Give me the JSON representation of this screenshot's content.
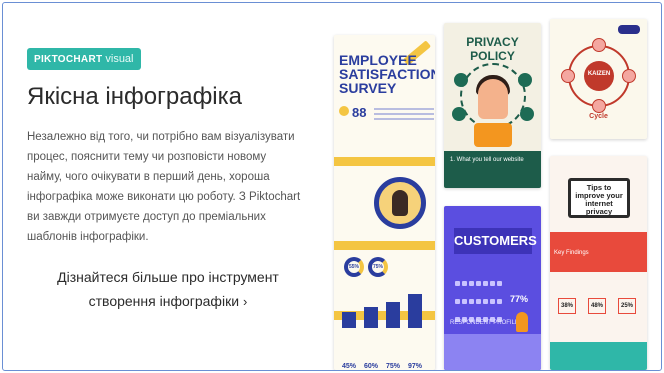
{
  "brand": {
    "name": "PIKTOCHART",
    "suffix": "visual"
  },
  "title": "Якісна інфографіка",
  "description": "Незалежно від того, чи потрібно вам візуалізувати процес, пояснити тему чи розповісти новому найму, чого очікувати в перший день, хороша інфографіка може виконати цю роботу. З Piktochart ви завжди отримуєте доступ до преміальних шаблонів інфографіки.",
  "cta": {
    "label": "Дізнайтеся більше про інструмент створення інфографіки",
    "chevron": "›"
  },
  "colors": {
    "teal": "#2fb7a8",
    "border": "#6a8fd4",
    "navy": "#2a3d9e",
    "yellow": "#f4c542",
    "green": "#1d5c4a",
    "purple": "#5b4ee0",
    "red": "#e84a3c"
  },
  "templates": {
    "survey": {
      "title": "EMPLOYEE SATISFACTION SURVEY",
      "stat": "88",
      "rings": [
        "55%",
        "75%"
      ],
      "bars": [
        45,
        60,
        75,
        97
      ],
      "bar_labels": [
        "45%",
        "60%",
        "75%",
        "97%"
      ]
    },
    "privacy": {
      "title": "PRIVACY POLICY",
      "caption": "1. What you tell our website"
    },
    "customers": {
      "title": "CUSTOMERS",
      "stat": "77%",
      "profile": "RESPONDENT PROFILE"
    },
    "kaizen": {
      "center": "KAIZEN",
      "label": "Cycle"
    },
    "internet": {
      "title": "Tips to improve your internet privacy",
      "red_caption": "Key Findings",
      "stats": [
        "38%",
        "48%",
        "25%"
      ]
    }
  }
}
